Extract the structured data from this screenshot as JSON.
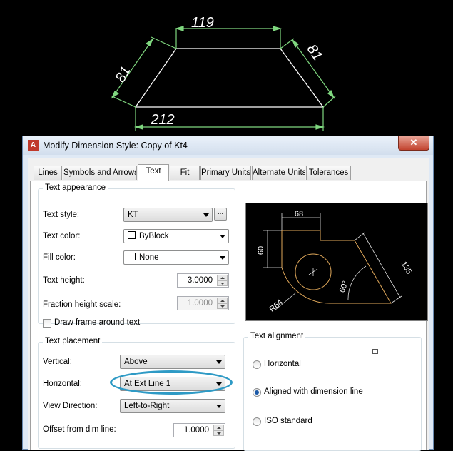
{
  "cad_drawing": {
    "top_dim": "119",
    "left_dim": "81",
    "right_dim": "81",
    "bottom_dim": "212",
    "line_color": "#ffffff",
    "dim_color": "#7fd77f"
  },
  "dialog": {
    "title": "Modify Dimension Style: Copy of Kt4",
    "close_label": "✕",
    "app_icon": "A"
  },
  "tabs": [
    "Lines",
    "Symbols and Arrows",
    "Text",
    "Fit",
    "Primary Units",
    "Alternate Units",
    "Tolerances"
  ],
  "active_tab": "Text",
  "text_appearance": {
    "title": "Text appearance",
    "text_style_label": "Text style:",
    "text_style_value": "KT",
    "ellipsis": "...",
    "text_color_label": "Text color:",
    "text_color_value": "ByBlock",
    "fill_color_label": "Fill color:",
    "fill_color_value": "None",
    "text_height_label": "Text height:",
    "text_height_value": "3.0000",
    "fraction_label": "Fraction height scale:",
    "fraction_value": "1.0000",
    "draw_frame_label": "Draw frame around text"
  },
  "text_placement": {
    "title": "Text placement",
    "vertical_label": "Vertical:",
    "vertical_value": "Above",
    "horizontal_label": "Horizontal:",
    "horizontal_value": "At Ext Line 1",
    "view_direction_label": "View Direction:",
    "view_direction_value": "Left-to-Right",
    "offset_label": "Offset from dim line:",
    "offset_value": "1.0000"
  },
  "preview": {
    "dim_68": "68",
    "dim_60": "60",
    "dim_135": "135",
    "dim_60deg": "60°",
    "dim_r64": "R64"
  },
  "text_alignment": {
    "title": "Text alignment",
    "options": [
      "Horizontal",
      "Aligned with dimension line",
      "ISO standard"
    ],
    "selected": "Aligned with dimension line"
  },
  "colors": {
    "highlight": "#2e9ac5",
    "preview_outline": "#e0a85a",
    "preview_dim": "#e0e0e0"
  }
}
